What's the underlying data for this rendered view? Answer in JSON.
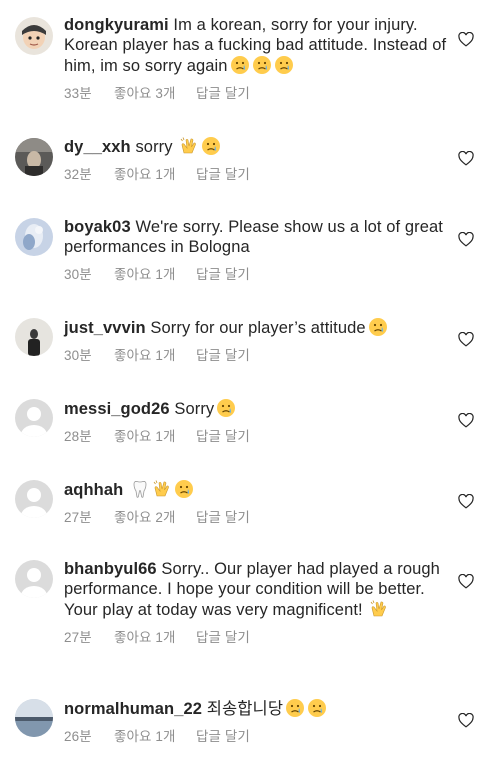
{
  "comments": [
    {
      "username": "dongkyurami",
      "text": "Im a korean, sorry for your injury. Korean player has a fucking bad attitude. Instead of him, im so sorry again",
      "emojis": [
        "crying-face-emoji",
        "crying-face-emoji",
        "crying-face-emoji"
      ],
      "time": "33분",
      "likes": "좋아요 3개",
      "reply": "답글 달기",
      "avatar": "cartoon"
    },
    {
      "username": "dy__xxh",
      "text": "sorry",
      "emojis": [
        "clapping-hands-emoji",
        "crying-face-emoji"
      ],
      "time": "32분",
      "likes": "좋아요 1개",
      "reply": "답글 달기",
      "avatar": "photo-dark"
    },
    {
      "username": "boyak03",
      "text": "We're sorry. Please show us a lot of great performances in Bologna",
      "emojis": [],
      "time": "30분",
      "likes": "좋아요 1개",
      "reply": "답글 달기",
      "avatar": "photo-blue"
    },
    {
      "username": "just_vvvin",
      "text": "Sorry for our player’s attitude",
      "emojis": [
        "crying-face-emoji"
      ],
      "time": "30분",
      "likes": "좋아요 1개",
      "reply": "답글 달기",
      "avatar": "photo-grey"
    },
    {
      "username": "messi_god26",
      "text": "Sorry",
      "emojis": [
        "crying-face-emoji"
      ],
      "time": "28분",
      "likes": "좋아요 1개",
      "reply": "답글 달기",
      "avatar": "placeholder"
    },
    {
      "username": "aqhhah",
      "text": "",
      "emojis": [
        "tooth-emoji",
        "clapping-hands-emoji",
        "crying-face-emoji"
      ],
      "time": "27분",
      "likes": "좋아요 2개",
      "reply": "답글 달기",
      "avatar": "placeholder"
    },
    {
      "username": "bhanbyul66",
      "text": "Sorry.. Our player had played a rough performance. I hope your condition will be better. Your play at today was very magnificent!",
      "emojis": [
        "clapping-hands-emoji"
      ],
      "time": "27분",
      "likes": "좋아요 1개",
      "reply": "답글 달기",
      "avatar": "placeholder"
    },
    {
      "username": "normalhuman_22",
      "text": "죄송합니당",
      "emojis": [
        "crying-face-emoji",
        "crying-face-emoji"
      ],
      "time": "26분",
      "likes": "좋아요 1개",
      "reply": "답글 달기",
      "avatar": "photo-sky"
    }
  ]
}
